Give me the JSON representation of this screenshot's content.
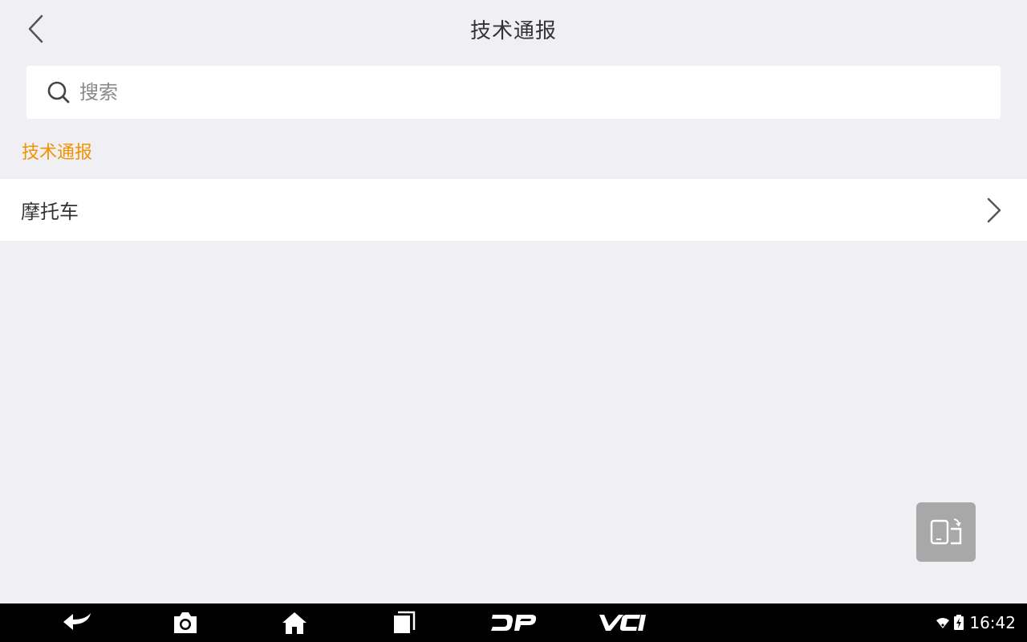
{
  "header": {
    "title": "技术通报",
    "back_icon": "chevron-left-icon"
  },
  "search": {
    "placeholder": "搜索",
    "value": "",
    "icon": "search-icon"
  },
  "section": {
    "label": "技术通报"
  },
  "list": {
    "items": [
      {
        "label": "摩托车",
        "icon": "chevron-right-icon"
      }
    ]
  },
  "floating_button": {
    "icon": "screen-rotate-icon"
  },
  "navbar": {
    "buttons": [
      {
        "name": "back",
        "icon": "back-arrow-icon"
      },
      {
        "name": "screenshot",
        "icon": "camera-icon"
      },
      {
        "name": "home",
        "icon": "home-icon"
      },
      {
        "name": "recent",
        "icon": "recent-apps-icon"
      },
      {
        "name": "dp",
        "label": "DP"
      },
      {
        "name": "vci",
        "label": "VCI"
      }
    ],
    "status": {
      "time": "16:42"
    }
  },
  "colors": {
    "background": "#efeff4",
    "accent": "#f39200",
    "text": "#333333",
    "navbar": "#000000",
    "float_button": "#a8a8a8"
  }
}
